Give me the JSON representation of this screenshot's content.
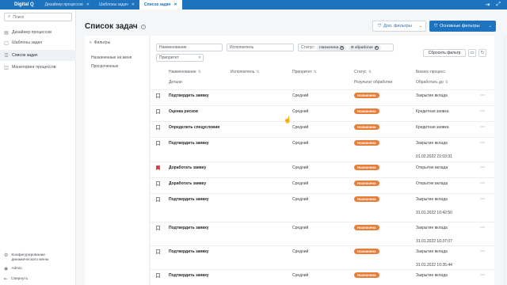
{
  "topbar": {
    "brand": "Digital Q",
    "tabs": [
      {
        "label": "Дизайнер процессов",
        "active": false
      },
      {
        "label": "Шаблоны задач",
        "active": false
      },
      {
        "label": "Список задач",
        "active": true
      }
    ]
  },
  "sidebar": {
    "search_placeholder": "Поиск",
    "items": [
      {
        "label": "Дизайнер процессов",
        "icon": "process-icon",
        "active": false
      },
      {
        "label": "Шаблоны задач",
        "icon": "template-icon",
        "active": false
      },
      {
        "label": "Список задач",
        "icon": "list-icon",
        "active": true
      },
      {
        "label": "Мониторинг процессов",
        "icon": "monitor-icon",
        "active": false
      }
    ],
    "bottom": {
      "config_line1": "Конфигурирование",
      "config_line2": "динамического меню",
      "user": "Admin",
      "collapse": "Свернуть"
    }
  },
  "header": {
    "title": "Список задач",
    "extra_filters": "Доп. фильтры",
    "main_filters": "Основные фильтры"
  },
  "filters_panel": {
    "title": "Фильтры",
    "items": [
      "Назначенные на меня",
      "Просроченные"
    ]
  },
  "filter_bar": {
    "name_placeholder": "Наименование",
    "executor_placeholder": "Исполнитель",
    "status_label": "Статус:",
    "status_pills": [
      "Назначена",
      "В обработке"
    ],
    "priority_placeholder": "Приоритет",
    "reset": "Сбросить фильтр"
  },
  "table": {
    "headers": {
      "name": "Наименование",
      "executor": "Исполнитель",
      "priority": "Приоритет",
      "status": "Статус",
      "process": "Бизнес-процесс",
      "details": "Детали",
      "result": "Результат обработки",
      "due": "Обработать до"
    },
    "rows": [
      {
        "name": "Подтвердить заявку",
        "priority": "Средний",
        "status": "Назначена",
        "process": "Закрытие вклада",
        "due": "",
        "flagged": false
      },
      {
        "name": "Оценка рисков",
        "priority": "Средний",
        "status": "Назначена",
        "process": "Кредитная заявка",
        "due": "",
        "flagged": false
      },
      {
        "name": "Определить спецусловия",
        "priority": "Средний",
        "status": "Назначена",
        "process": "Кредитная заявка",
        "due": "",
        "flagged": false
      },
      {
        "name": "Подтвердить заявку",
        "priority": "Средний",
        "status": "Назначена",
        "process": "Закрытие вклада",
        "due": "01.02.2022 21:03:31",
        "flagged": false
      },
      {
        "name": "Доработать заявку",
        "priority": "Средний",
        "status": "Назначена",
        "process": "Открытие вклада",
        "due": "",
        "flagged": true
      },
      {
        "name": "Доработать заявку",
        "priority": "Средний",
        "status": "Назначена",
        "process": "Открытие вклада",
        "due": "",
        "flagged": false
      },
      {
        "name": "Подтвердить заявку",
        "priority": "Средний",
        "status": "Назначена",
        "process": "Закрытие вклада",
        "due": "31.01.2022 10:42:50",
        "flagged": false
      },
      {
        "name": "Подтвердить заявку",
        "priority": "Средний",
        "status": "Назначена",
        "process": "Закрытие вклада",
        "due": "31.01.2022 10:37:07",
        "flagged": false
      },
      {
        "name": "Подтвердить заявку",
        "priority": "Средний",
        "status": "Назначена",
        "process": "Закрытие вклада",
        "due": "31.01.2022 10:35:44",
        "flagged": false
      },
      {
        "name": "Подтвердить заявку",
        "priority": "Средний",
        "status": "Назначена",
        "process": "Закрытие вклада",
        "due": "",
        "flagged": false
      }
    ]
  },
  "colors": {
    "primary": "#1e73be",
    "badge": "#e67e3a",
    "flag": "#d9363e"
  }
}
